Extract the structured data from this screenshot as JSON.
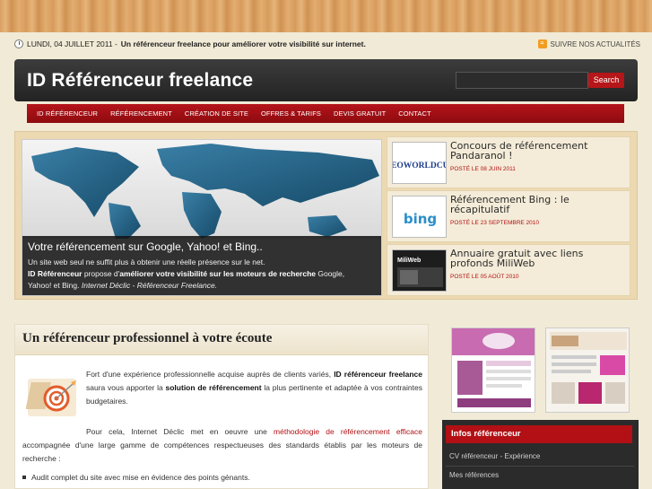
{
  "topbar": {
    "date": "LUNDI, 04 JUILLET 2011 -",
    "tagline": "Un référenceur freelance pour améliorer votre visibilité sur internet.",
    "rss_label": "SUIVRE NOS ACTUALITÉS"
  },
  "header": {
    "site_title": "ID Référenceur freelance",
    "search_placeholder": "",
    "search_button": "Search"
  },
  "nav": {
    "items": [
      "ID RÉFÉRENCEUR",
      "RÉFÉRENCEMENT",
      "CRÉATION DE SITE",
      "OFFRES & TARIFS",
      "DEVIS GRATUIT",
      "CONTACT"
    ]
  },
  "slide": {
    "title": "Votre référencement sur Google, Yahoo! et Bing..",
    "line1": "Un site web seul ne suffit plus à obtenir une réelle présence sur le net.",
    "strong1": "ID Référenceur",
    "mid1": " propose d'",
    "strong2": "améliorer votre visibilité sur les moteurs de recherche",
    "tail1": " Google,",
    "tail2": "Yahoo! et Bing. ",
    "italic": "Internet Déclic - Référenceur Freelance."
  },
  "posts": [
    {
      "title": "Concours de référencement Pandaranol !",
      "date": "POSTÉ LE 08 JUIN 2011",
      "thumb": "SEOWORLDCUP"
    },
    {
      "title": "Référencement Bing : le récapitulatif",
      "date": "POSTÉ LE 23 SEPTEMBRE 2010",
      "thumb": "bing"
    },
    {
      "title": "Annuaire gratuit avec liens profonds MiliWeb",
      "date": "POSTÉ LE 05 AOÛT 2010",
      "thumb": "MiliWeb"
    }
  ],
  "content": {
    "title": "Un référenceur professionnel à votre écoute",
    "p1_a": "Fort d'une expérience professionnelle acquise auprès de clients variés, ",
    "p1_b": "ID référenceur freelance",
    "p1_c": " saura vous apporter la ",
    "p1_d": "solution de référencement",
    "p1_e": " la plus pertinente et adaptée à vos contraintes budgetaires.",
    "p2_a": "Pour cela, Internet Déclic met en oeuvre une ",
    "p2_link": "méthodologie de référencement efficace",
    "p2_b": " accompagnée d'une large gamme de compétences respectueuses des standards établis par les moteurs de recherche :",
    "bullet1": "Audit complet du site avec mise en évidence des points génants."
  },
  "sidebar": {
    "box_title": "Infos référenceur",
    "links": [
      "CV référenceur - Expérience",
      "Mes références"
    ]
  },
  "colors": {
    "accent": "#b21014",
    "header_bg": "#2e2e2e",
    "page_bg": "#f1ead6"
  }
}
